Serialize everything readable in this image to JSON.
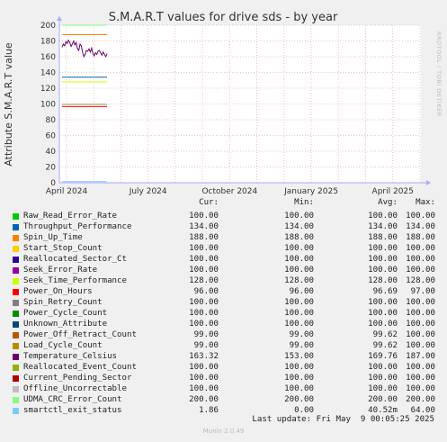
{
  "chart_data": {
    "type": "line",
    "title": "S.M.A.R.T values for drive sds - by year",
    "ylabel": "Attribute S.M.A.R.T value",
    "side_label": "RRDTOOL / TOBI OETIKER",
    "ylim": [
      0,
      200
    ],
    "y_ticks": [
      0,
      20,
      40,
      60,
      80,
      100,
      120,
      140,
      160,
      180,
      200
    ],
    "x_ticks": [
      "April 2024",
      "July 2024",
      "October 2024",
      "January 2025",
      "April 2025"
    ],
    "grid": true,
    "series": [
      {
        "name": "Raw_Read_Error_Rate",
        "color": "#00cc00",
        "cur": "100.00",
        "min": "100.00",
        "avg": "100.00",
        "max": "100.00"
      },
      {
        "name": "Throughput_Performance",
        "color": "#0066b3",
        "cur": "134.00",
        "min": "134.00",
        "avg": "134.00",
        "max": "134.00"
      },
      {
        "name": "Spin_Up_Time",
        "color": "#ff8000",
        "cur": "188.00",
        "min": "188.00",
        "avg": "188.00",
        "max": "188.00"
      },
      {
        "name": "Start_Stop_Count",
        "color": "#ffcc00",
        "cur": "100.00",
        "min": "100.00",
        "avg": "100.00",
        "max": "100.00"
      },
      {
        "name": "Reallocated_Sector_Ct",
        "color": "#330099",
        "cur": "100.00",
        "min": "100.00",
        "avg": "100.00",
        "max": "100.00"
      },
      {
        "name": "Seek_Error_Rate",
        "color": "#990099",
        "cur": "100.00",
        "min": "100.00",
        "avg": "100.00",
        "max": "100.00"
      },
      {
        "name": "Seek_Time_Performance",
        "color": "#ccff00",
        "cur": "128.00",
        "min": "128.00",
        "avg": "128.00",
        "max": "128.00"
      },
      {
        "name": "Power_On_Hours",
        "color": "#ff0000",
        "cur": "96.00",
        "min": "96.00",
        "avg": "96.69",
        "max": "97.00"
      },
      {
        "name": "Spin_Retry_Count",
        "color": "#808080",
        "cur": "100.00",
        "min": "100.00",
        "avg": "100.00",
        "max": "100.00"
      },
      {
        "name": "Power_Cycle_Count",
        "color": "#008f00",
        "cur": "100.00",
        "min": "100.00",
        "avg": "100.00",
        "max": "100.00"
      },
      {
        "name": "Unknown_Attribute",
        "color": "#00487d",
        "cur": "100.00",
        "min": "100.00",
        "avg": "100.00",
        "max": "100.00"
      },
      {
        "name": "Power_Off_Retract_Count",
        "color": "#b35a00",
        "cur": "99.00",
        "min": "99.00",
        "avg": "99.62",
        "max": "100.00"
      },
      {
        "name": "Load_Cycle_Count",
        "color": "#b38f00",
        "cur": "99.00",
        "min": "99.00",
        "avg": "99.62",
        "max": "100.00"
      },
      {
        "name": "Temperature_Celsius",
        "color": "#6b006b",
        "cur": "163.32",
        "min": "153.00",
        "avg": "169.76",
        "max": "187.00"
      },
      {
        "name": "Reallocated_Event_Count",
        "color": "#8fb300",
        "cur": "100.00",
        "min": "100.00",
        "avg": "100.00",
        "max": "100.00"
      },
      {
        "name": "Current_Pending_Sector",
        "color": "#b30000",
        "cur": "100.00",
        "min": "100.00",
        "avg": "100.00",
        "max": "100.00"
      },
      {
        "name": "Offline_Uncorrectable",
        "color": "#bebebe",
        "cur": "100.00",
        "min": "100.00",
        "avg": "100.00",
        "max": "100.00"
      },
      {
        "name": "UDMA_CRC_Error_Count",
        "color": "#80ff80",
        "cur": "200.00",
        "min": "200.00",
        "avg": "200.00",
        "max": "200.00"
      },
      {
        "name": "smartctl_exit_status",
        "color": "#80c9ff",
        "cur": "1.86",
        "min": "0.00",
        "avg": "40.52m",
        "max": "64.00"
      }
    ],
    "temperature_samples": [
      172,
      176,
      174,
      179,
      177,
      181,
      178,
      173,
      176,
      180,
      175,
      178,
      170,
      168,
      176,
      174,
      165,
      160,
      163,
      168,
      167,
      170,
      166,
      171,
      164,
      161,
      165,
      163,
      167,
      168,
      165,
      162,
      166,
      163,
      160,
      164
    ]
  },
  "legend": {
    "header": {
      "cur": "Cur:",
      "min": "Min:",
      "avg": "Avg:",
      "max": "Max:"
    },
    "last_update": "Last update: Fri May  9 00:05:25 2025"
  },
  "footer": {
    "munin": "Munin 2.0.49"
  }
}
